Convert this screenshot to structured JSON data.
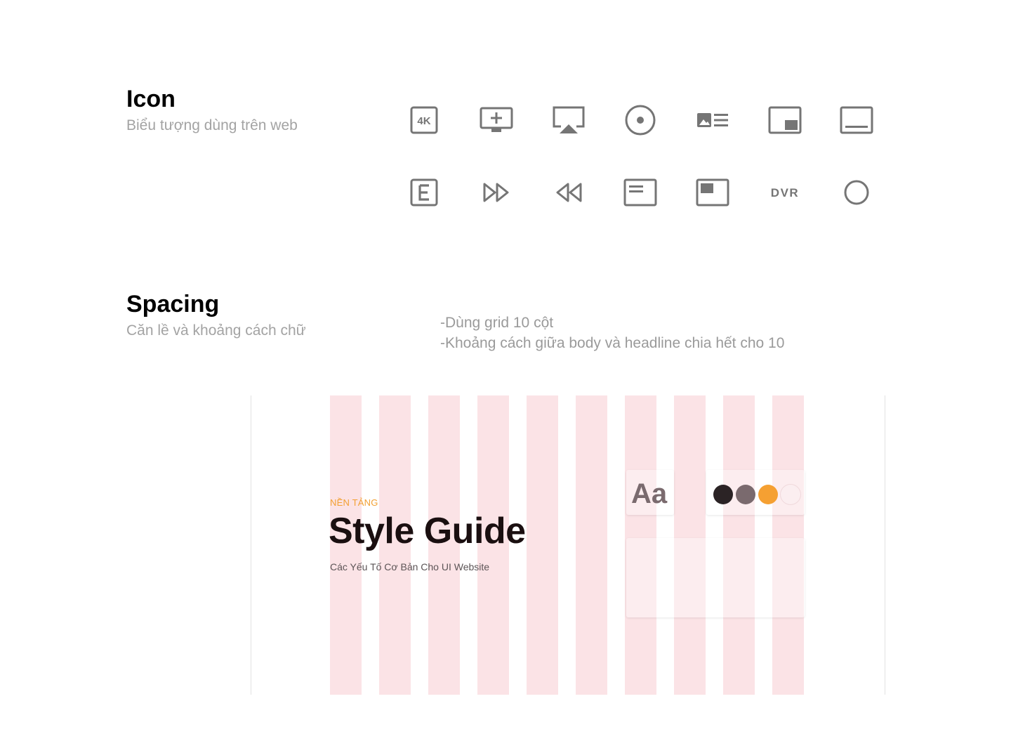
{
  "icon_section": {
    "title": "Icon",
    "subtitle": "Biểu tượng dùng trên web",
    "row1": [
      "4k-icon",
      "add-to-queue-icon",
      "airplay-icon",
      "album-icon",
      "art-track-icon",
      "picture-in-picture-icon",
      "subtitles-icon"
    ],
    "row2": [
      "explicit-icon",
      "fast-forward-icon",
      "fast-rewind-icon",
      "featured-play-list-icon",
      "featured-video-icon",
      "dvr-icon",
      "circle-icon"
    ],
    "dvr_label": "DVR",
    "k4_label": "4K",
    "icon_color": "#757575"
  },
  "spacing_section": {
    "title": "Spacing",
    "subtitle": "Căn lề và khoảng cách chữ",
    "notes": [
      "-Dùng grid 10 cột",
      "-Khoảng cách giữa body và headline chia hết cho 10"
    ]
  },
  "preview": {
    "grid_columns": 10,
    "column_color": "#fbe3e6",
    "eyebrow": "NỀN TẢNG",
    "headline": "Style Guide",
    "subheadline": "Các Yếu Tố Cơ Bản Cho UI Website",
    "type_sample": "Aa",
    "palette": [
      "#2b2325",
      "#7a6a6e",
      "#f5a032",
      "#fbeef0"
    ],
    "accent_color": "#f2a033"
  }
}
